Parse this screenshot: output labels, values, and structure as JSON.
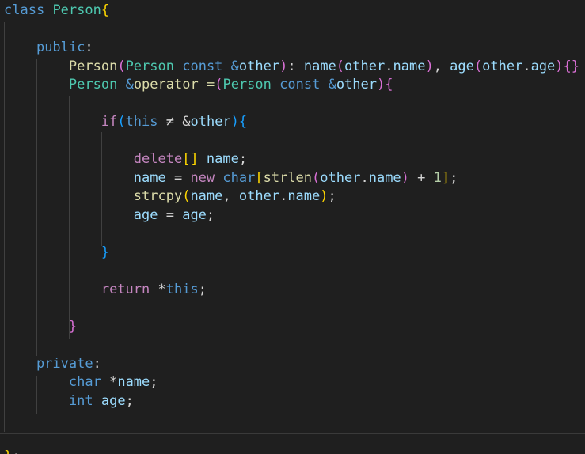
{
  "editor": {
    "language": "cpp",
    "colors": {
      "background": "#1f1f1f",
      "default": "#d4d4d4",
      "keyword": "#569cd6",
      "control": "#c586c0",
      "type": "#4ec9b0",
      "function": "#dcdcaa",
      "variable": "#9cdcfe",
      "number": "#b5cea8",
      "bracket1": "#ffd700",
      "bracket2": "#da70d6",
      "bracket3": "#179fff",
      "indent_guide": "#404040"
    },
    "lines": [
      {
        "tokens": [
          {
            "t": "class",
            "c": "keyword"
          },
          {
            "t": " "
          },
          {
            "t": "Person",
            "c": "type"
          },
          {
            "t": "{",
            "c": "bracket1"
          }
        ]
      },
      {
        "tokens": []
      },
      {
        "tokens": [
          {
            "t": "    "
          },
          {
            "t": "public",
            "c": "keyword"
          },
          {
            "t": ":"
          }
        ]
      },
      {
        "tokens": [
          {
            "t": "        "
          },
          {
            "t": "Person",
            "c": "function"
          },
          {
            "t": "(",
            "c": "bracket2"
          },
          {
            "t": "Person",
            "c": "type"
          },
          {
            "t": " "
          },
          {
            "t": "const",
            "c": "keyword"
          },
          {
            "t": " "
          },
          {
            "t": "&",
            "c": "keyword"
          },
          {
            "t": "other",
            "c": "variable"
          },
          {
            "t": ")",
            "c": "bracket2"
          },
          {
            "t": ": "
          },
          {
            "t": "name",
            "c": "variable"
          },
          {
            "t": "(",
            "c": "bracket2"
          },
          {
            "t": "other",
            "c": "variable"
          },
          {
            "t": "."
          },
          {
            "t": "name",
            "c": "variable"
          },
          {
            "t": ")",
            "c": "bracket2"
          },
          {
            "t": ", "
          },
          {
            "t": "age",
            "c": "variable"
          },
          {
            "t": "(",
            "c": "bracket2"
          },
          {
            "t": "other",
            "c": "variable"
          },
          {
            "t": "."
          },
          {
            "t": "age",
            "c": "variable"
          },
          {
            "t": ")",
            "c": "bracket2"
          },
          {
            "t": "{}",
            "c": "bracket2"
          }
        ]
      },
      {
        "tokens": [
          {
            "t": "        "
          },
          {
            "t": "Person",
            "c": "type"
          },
          {
            "t": " "
          },
          {
            "t": "&",
            "c": "keyword"
          },
          {
            "t": "operator",
            "c": "function"
          },
          {
            "t": " "
          },
          {
            "t": "=",
            "c": "function"
          },
          {
            "t": "(",
            "c": "bracket2"
          },
          {
            "t": "Person",
            "c": "type"
          },
          {
            "t": " "
          },
          {
            "t": "const",
            "c": "keyword"
          },
          {
            "t": " "
          },
          {
            "t": "&",
            "c": "keyword"
          },
          {
            "t": "other",
            "c": "variable"
          },
          {
            "t": ")",
            "c": "bracket2"
          },
          {
            "t": "{",
            "c": "bracket2"
          }
        ]
      },
      {
        "tokens": []
      },
      {
        "tokens": [
          {
            "t": "            "
          },
          {
            "t": "if",
            "c": "control"
          },
          {
            "t": "(",
            "c": "bracket3"
          },
          {
            "t": "this",
            "c": "keyword"
          },
          {
            "t": " ≠ "
          },
          {
            "t": "&"
          },
          {
            "t": "other",
            "c": "variable"
          },
          {
            "t": ")",
            "c": "bracket3"
          },
          {
            "t": "{",
            "c": "bracket3"
          }
        ]
      },
      {
        "tokens": []
      },
      {
        "tokens": [
          {
            "t": "                "
          },
          {
            "t": "delete",
            "c": "control"
          },
          {
            "t": "[]",
            "c": "bracket1"
          },
          {
            "t": " "
          },
          {
            "t": "name",
            "c": "variable"
          },
          {
            "t": ";"
          }
        ]
      },
      {
        "tokens": [
          {
            "t": "                "
          },
          {
            "t": "name",
            "c": "variable"
          },
          {
            "t": " = "
          },
          {
            "t": "new",
            "c": "control"
          },
          {
            "t": " "
          },
          {
            "t": "char",
            "c": "keyword"
          },
          {
            "t": "[",
            "c": "bracket1"
          },
          {
            "t": "strlen",
            "c": "function"
          },
          {
            "t": "(",
            "c": "bracket2"
          },
          {
            "t": "other",
            "c": "variable"
          },
          {
            "t": "."
          },
          {
            "t": "name",
            "c": "variable"
          },
          {
            "t": ")",
            "c": "bracket2"
          },
          {
            "t": " + "
          },
          {
            "t": "1",
            "c": "number"
          },
          {
            "t": "]",
            "c": "bracket1"
          },
          {
            "t": ";"
          }
        ]
      },
      {
        "tokens": [
          {
            "t": "                "
          },
          {
            "t": "strcpy",
            "c": "function"
          },
          {
            "t": "(",
            "c": "bracket1"
          },
          {
            "t": "name",
            "c": "variable"
          },
          {
            "t": ", "
          },
          {
            "t": "other",
            "c": "variable"
          },
          {
            "t": "."
          },
          {
            "t": "name",
            "c": "variable"
          },
          {
            "t": ")",
            "c": "bracket1"
          },
          {
            "t": ";"
          }
        ]
      },
      {
        "tokens": [
          {
            "t": "                "
          },
          {
            "t": "age",
            "c": "variable"
          },
          {
            "t": " = "
          },
          {
            "t": "age",
            "c": "variable"
          },
          {
            "t": ";"
          }
        ]
      },
      {
        "tokens": []
      },
      {
        "tokens": [
          {
            "t": "            "
          },
          {
            "t": "}",
            "c": "bracket3"
          }
        ]
      },
      {
        "tokens": []
      },
      {
        "tokens": [
          {
            "t": "            "
          },
          {
            "t": "return",
            "c": "control"
          },
          {
            "t": " *"
          },
          {
            "t": "this",
            "c": "keyword"
          },
          {
            "t": ";"
          }
        ]
      },
      {
        "tokens": []
      },
      {
        "tokens": [
          {
            "t": "        "
          },
          {
            "t": "}",
            "c": "bracket2"
          }
        ]
      },
      {
        "tokens": []
      },
      {
        "tokens": [
          {
            "t": "    "
          },
          {
            "t": "private",
            "c": "keyword"
          },
          {
            "t": ":"
          }
        ]
      },
      {
        "tokens": [
          {
            "t": "        "
          },
          {
            "t": "char",
            "c": "keyword"
          },
          {
            "t": " *"
          },
          {
            "t": "name",
            "c": "variable"
          },
          {
            "t": ";"
          }
        ]
      },
      {
        "tokens": [
          {
            "t": "        "
          },
          {
            "t": "int",
            "c": "keyword"
          },
          {
            "t": " "
          },
          {
            "t": "age",
            "c": "variable"
          },
          {
            "t": ";"
          }
        ]
      },
      {
        "tokens": []
      },
      {
        "tokens": []
      },
      {
        "tokens": [
          {
            "t": "}",
            "c": "bracket1"
          },
          {
            "t": ";"
          }
        ]
      }
    ]
  }
}
